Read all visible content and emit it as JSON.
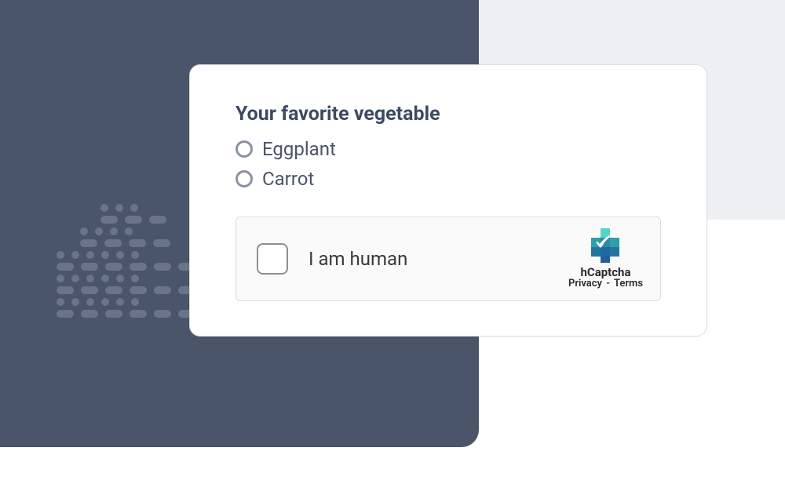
{
  "question": {
    "title": "Your favorite vegetable",
    "options": [
      {
        "label": "Eggplant"
      },
      {
        "label": "Carrot"
      }
    ]
  },
  "captcha": {
    "label": "I am human",
    "brand": "hCaptcha",
    "privacy": "Privacy",
    "separator": "-",
    "terms": "Terms"
  }
}
